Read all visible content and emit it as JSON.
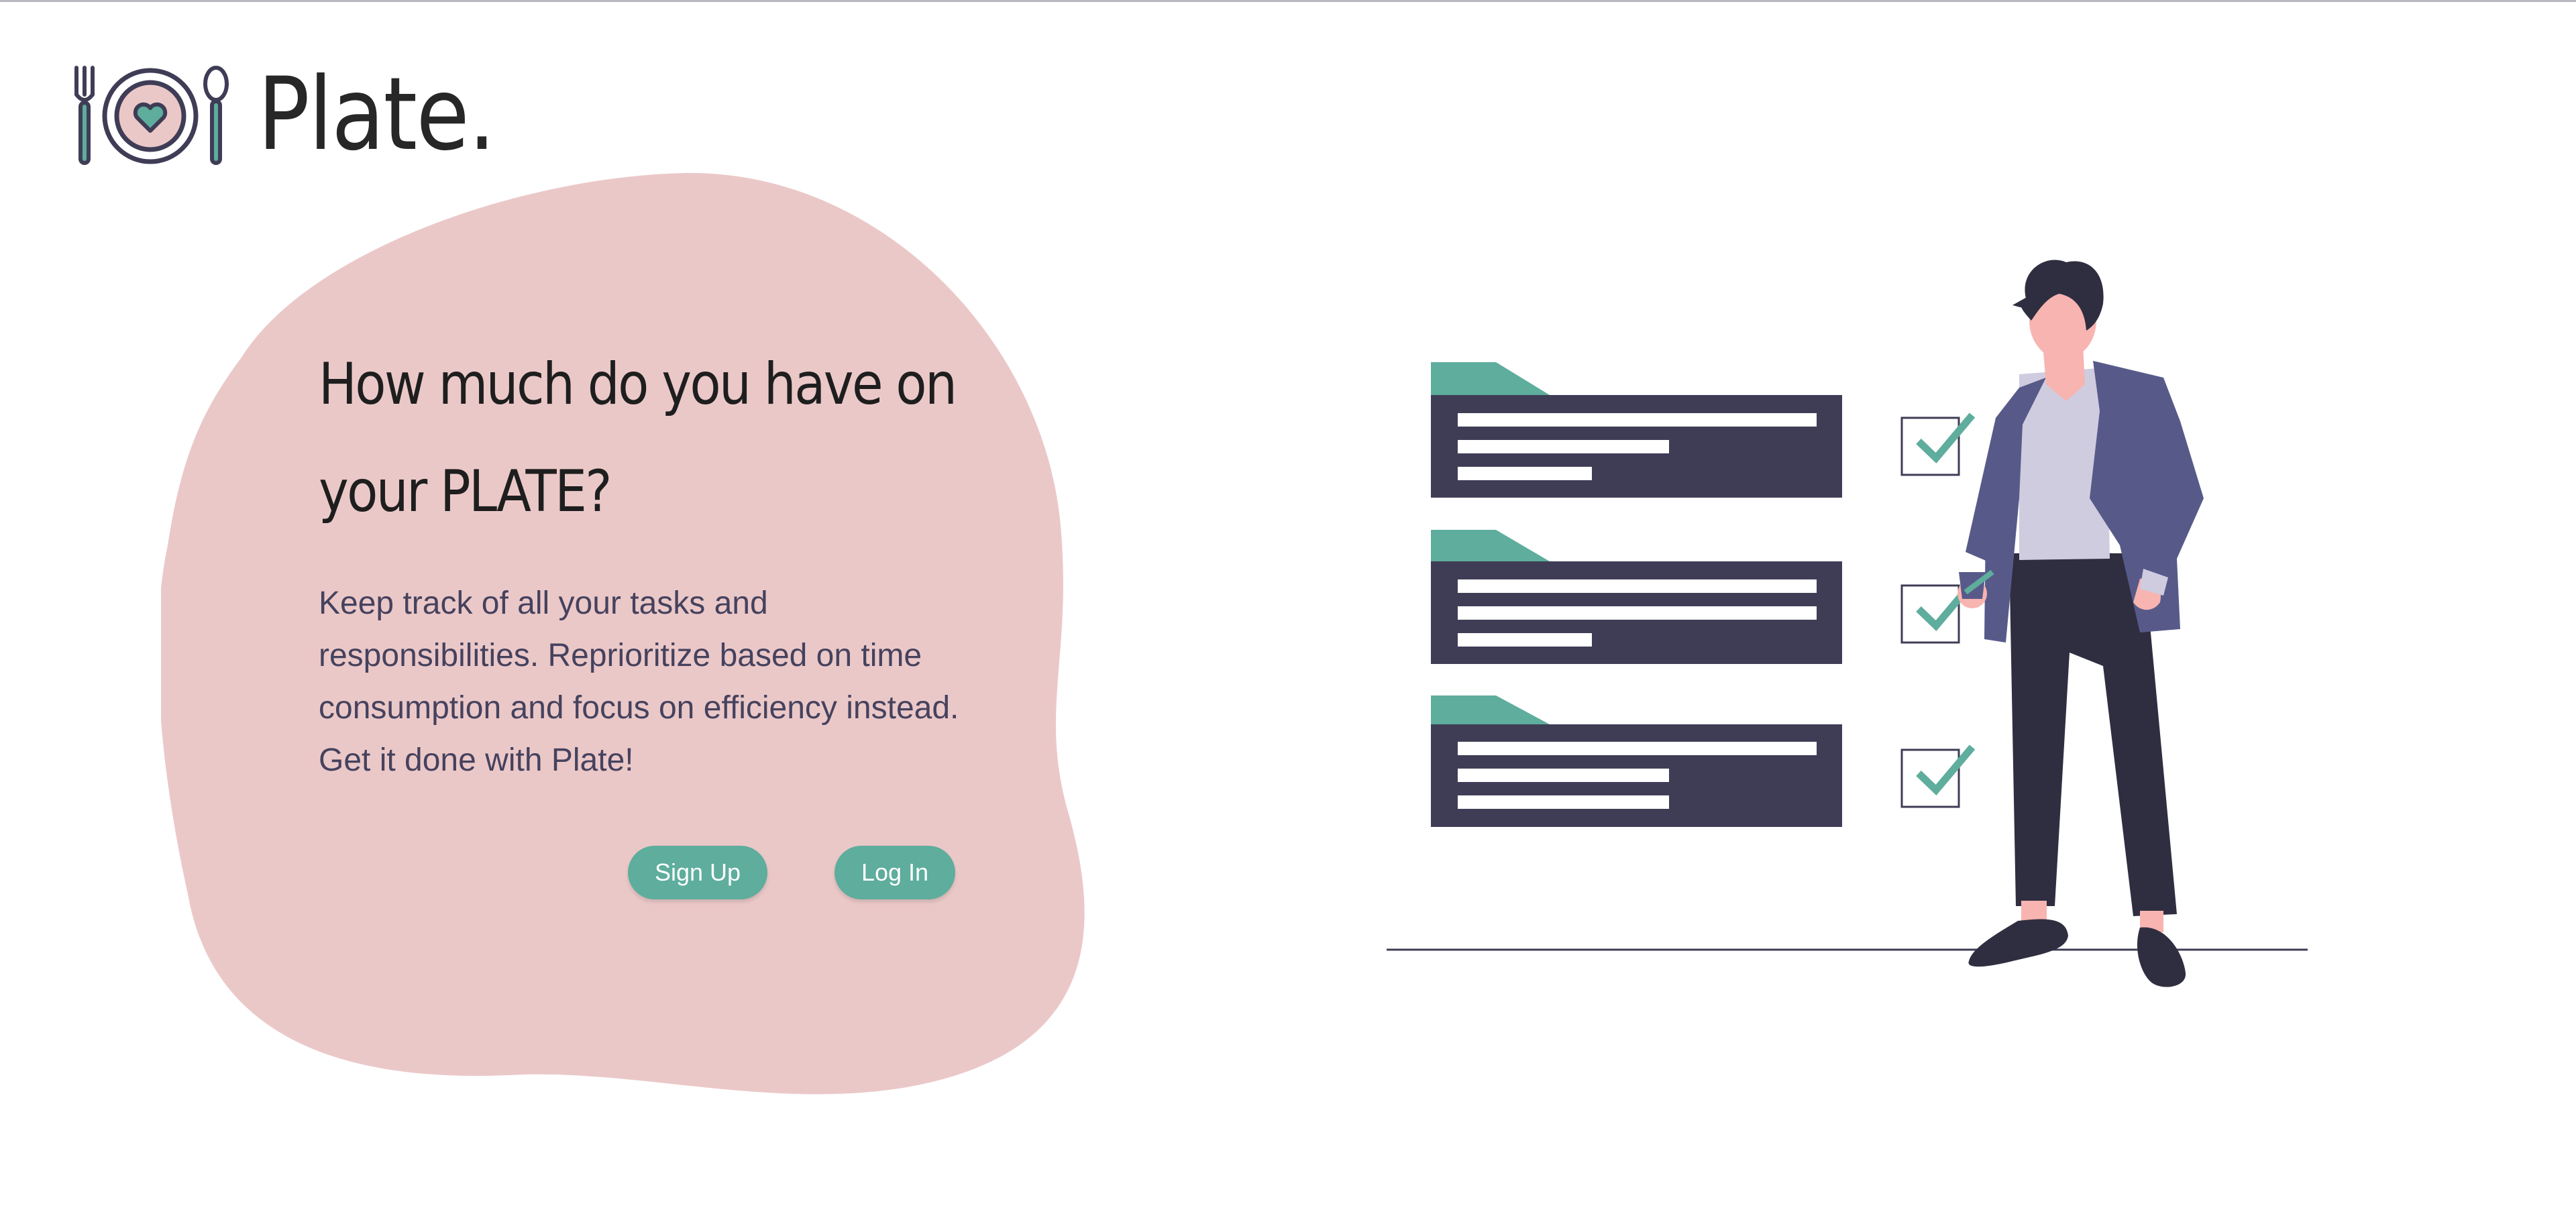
{
  "brand": {
    "name": "Plate.",
    "logo_icon": "fork-plate-spoon-icon",
    "colors": {
      "plate_pink": "#ebc8c8",
      "heart_teal": "#5ead9d",
      "outline": "#3f3d56"
    }
  },
  "hero": {
    "title": "How much do you have on your PLATE?",
    "description": "Keep track of all your tasks and responsibilities. Reprioritize based on time consumption and focus on efficiency instead. Get it done with Plate!",
    "blob_color": "#ebc8c8"
  },
  "actions": {
    "signup_label": "Sign Up",
    "login_label": "Log In",
    "button_color": "#5ead9d"
  },
  "illustration": {
    "name": "checklist-person-illustration",
    "task_cards": 3,
    "checked_boxes": 3,
    "colors": {
      "card": "#3f3d56",
      "tab": "#5ead9d",
      "jacket": "#575a89",
      "shirt": "#cfcce0",
      "skin": "#f8b4b0",
      "dark": "#2f2e41"
    }
  }
}
